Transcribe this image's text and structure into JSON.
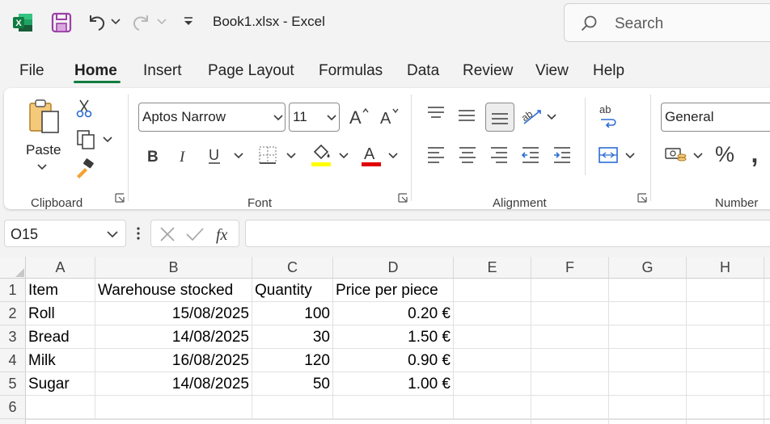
{
  "titlebar": {
    "title": "Book1.xlsx  -  Excel",
    "search_placeholder": "Search"
  },
  "tabs": [
    {
      "label": "File"
    },
    {
      "label": "Home"
    },
    {
      "label": "Insert"
    },
    {
      "label": "Page Layout"
    },
    {
      "label": "Formulas"
    },
    {
      "label": "Data"
    },
    {
      "label": "Review"
    },
    {
      "label": "View"
    },
    {
      "label": "Help"
    }
  ],
  "ribbon": {
    "clipboard": {
      "label": "Clipboard",
      "paste_label": "Paste"
    },
    "font": {
      "label": "Font",
      "font_name": "Aptos Narrow",
      "font_size": "11",
      "highlight_color": "#ffff00",
      "font_color": "#e00000"
    },
    "alignment": {
      "label": "Alignment"
    },
    "number": {
      "label": "Number",
      "format": "General"
    }
  },
  "formula_bar": {
    "name_box": "O15",
    "formula": ""
  },
  "grid": {
    "columns": [
      "A",
      "B",
      "C",
      "D",
      "E",
      "F",
      "G",
      "H"
    ],
    "rows": [
      {
        "num": "1",
        "cells": [
          "Item",
          "Warehouse stocked",
          "Quantity",
          "Price per piece"
        ]
      },
      {
        "num": "2",
        "cells": [
          "Roll",
          "15/08/2025",
          "100",
          "0.20 €"
        ]
      },
      {
        "num": "3",
        "cells": [
          "Bread",
          "14/08/2025",
          "30",
          "1.50 €"
        ]
      },
      {
        "num": "4",
        "cells": [
          "Milk",
          "16/08/2025",
          "120",
          "0.90 €"
        ]
      },
      {
        "num": "5",
        "cells": [
          "Sugar",
          "14/08/2025",
          "50",
          "1.00 €"
        ]
      },
      {
        "num": "6",
        "cells": [
          "",
          "",
          "",
          ""
        ]
      }
    ]
  },
  "colors": {
    "accent": "#117d3f",
    "excel_green": "#107c41",
    "save_purple": "#9b3fa8"
  }
}
